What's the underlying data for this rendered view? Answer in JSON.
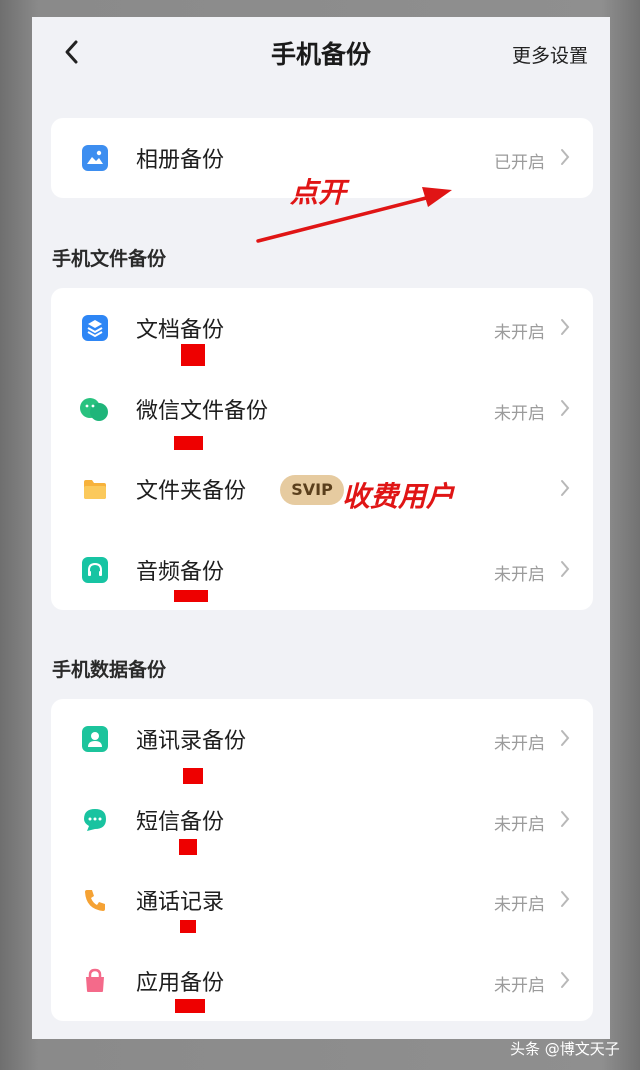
{
  "header": {
    "title": "手机备份",
    "more_settings": "更多设置"
  },
  "album": {
    "label": "相册备份",
    "status": "已开启"
  },
  "file_section": {
    "title": "手机文件备份",
    "items": [
      {
        "label": "文档备份",
        "status": "未开启"
      },
      {
        "label": "微信文件备份",
        "status": "未开启"
      },
      {
        "label": "文件夹备份",
        "status": "",
        "badge": "SVIP"
      },
      {
        "label": "音频备份",
        "status": "未开启"
      }
    ]
  },
  "data_section": {
    "title": "手机数据备份",
    "items": [
      {
        "label": "通讯录备份",
        "status": "未开启"
      },
      {
        "label": "短信备份",
        "status": "未开启"
      },
      {
        "label": "通话记录",
        "status": "未开启"
      },
      {
        "label": "应用备份",
        "status": "未开启"
      }
    ]
  },
  "annotations": {
    "tap_open": "点开",
    "paid_user": "收费用户"
  },
  "watermark": "头条 @博文天子",
  "colors": {
    "accent_red": "#ee0000",
    "page_bg": "#f1f2f6",
    "card_bg": "#ffffff",
    "status_text": "#9b9b9b",
    "svip_badge": "#e6cba0"
  },
  "icons": {
    "album": "photo-album-icon",
    "doc": "document-stack-icon",
    "wechat": "wechat-icon",
    "folder": "folder-icon",
    "audio": "headphones-icon",
    "contacts": "contact-person-icon",
    "sms": "chat-bubble-icon",
    "call": "phone-handset-icon",
    "app": "app-bag-icon"
  }
}
